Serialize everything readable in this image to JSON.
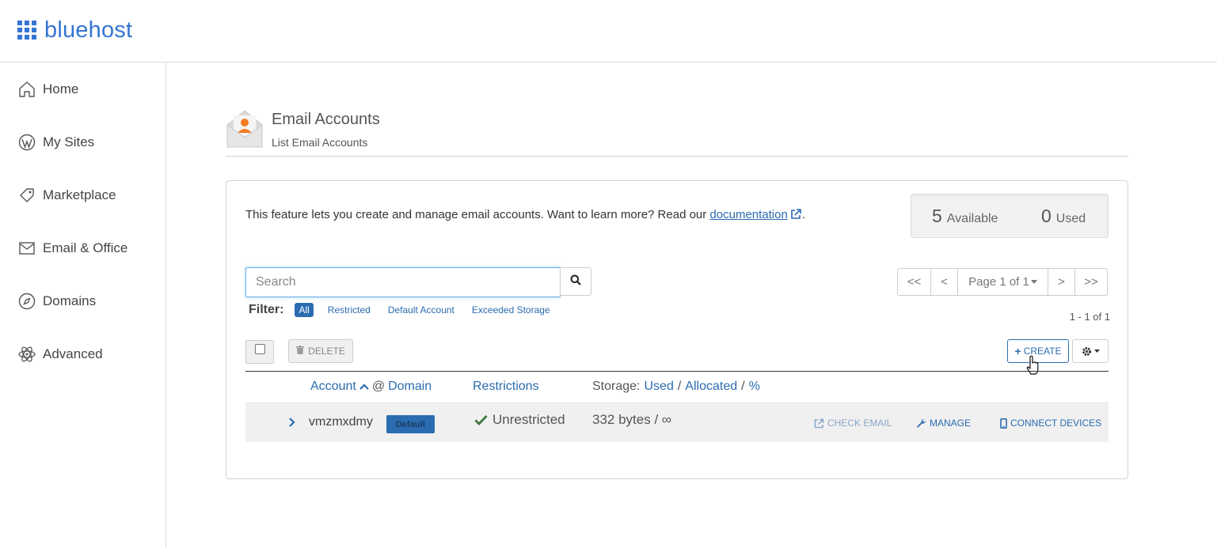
{
  "brand": {
    "name": "bluehost",
    "color": "#3575d3"
  },
  "sidebar": {
    "items": [
      {
        "label": "Home",
        "icon": "home-icon"
      },
      {
        "label": "My Sites",
        "icon": "wordpress-icon"
      },
      {
        "label": "Marketplace",
        "icon": "tag-icon"
      },
      {
        "label": "Email & Office",
        "icon": "envelope-icon"
      },
      {
        "label": "Domains",
        "icon": "compass-icon"
      },
      {
        "label": "Advanced",
        "icon": "atom-icon"
      }
    ]
  },
  "page": {
    "title": "Email Accounts",
    "subtitle": "List Email Accounts",
    "icon": "email-accounts-icon"
  },
  "intro": {
    "text": "This feature lets you create and manage email accounts. Want to learn more? Read our ",
    "link": "documentation",
    "suffix": "."
  },
  "stats": {
    "available_count": "5",
    "available_label": "Available",
    "used_count": "0",
    "used_label": "Used"
  },
  "search": {
    "placeholder": "Search",
    "value": ""
  },
  "filter": {
    "label": "Filter:",
    "options": [
      "All",
      "Restricted",
      "Default Account",
      "Exceeded Storage"
    ],
    "active": "All"
  },
  "pager": {
    "first": "<<",
    "prev": "<",
    "page": "Page 1 of 1",
    "next": ">",
    "last": ">>"
  },
  "range_text": "1 - 1 of 1",
  "toolbar": {
    "delete_label": "DELETE",
    "create_label": "CREATE"
  },
  "table": {
    "headers": {
      "account": "Account",
      "at_domain_at": "@",
      "domain": "Domain",
      "restrictions": "Restrictions",
      "storage_label": "Storage:",
      "used": "Used",
      "sep1": "/",
      "allocated": "Allocated",
      "sep2": "/",
      "percent": "%"
    },
    "rows": [
      {
        "account": "vmzmxdmy",
        "badge": "Default",
        "restriction": "Unrestricted",
        "storage": "332 bytes / ∞",
        "actions": [
          "CHECK EMAIL",
          "MANAGE",
          "CONNECT DEVICES"
        ]
      }
    ]
  },
  "colors": {
    "link": "#2b6cb0",
    "success": "#3c763d",
    "border": "#d3d3d3"
  }
}
